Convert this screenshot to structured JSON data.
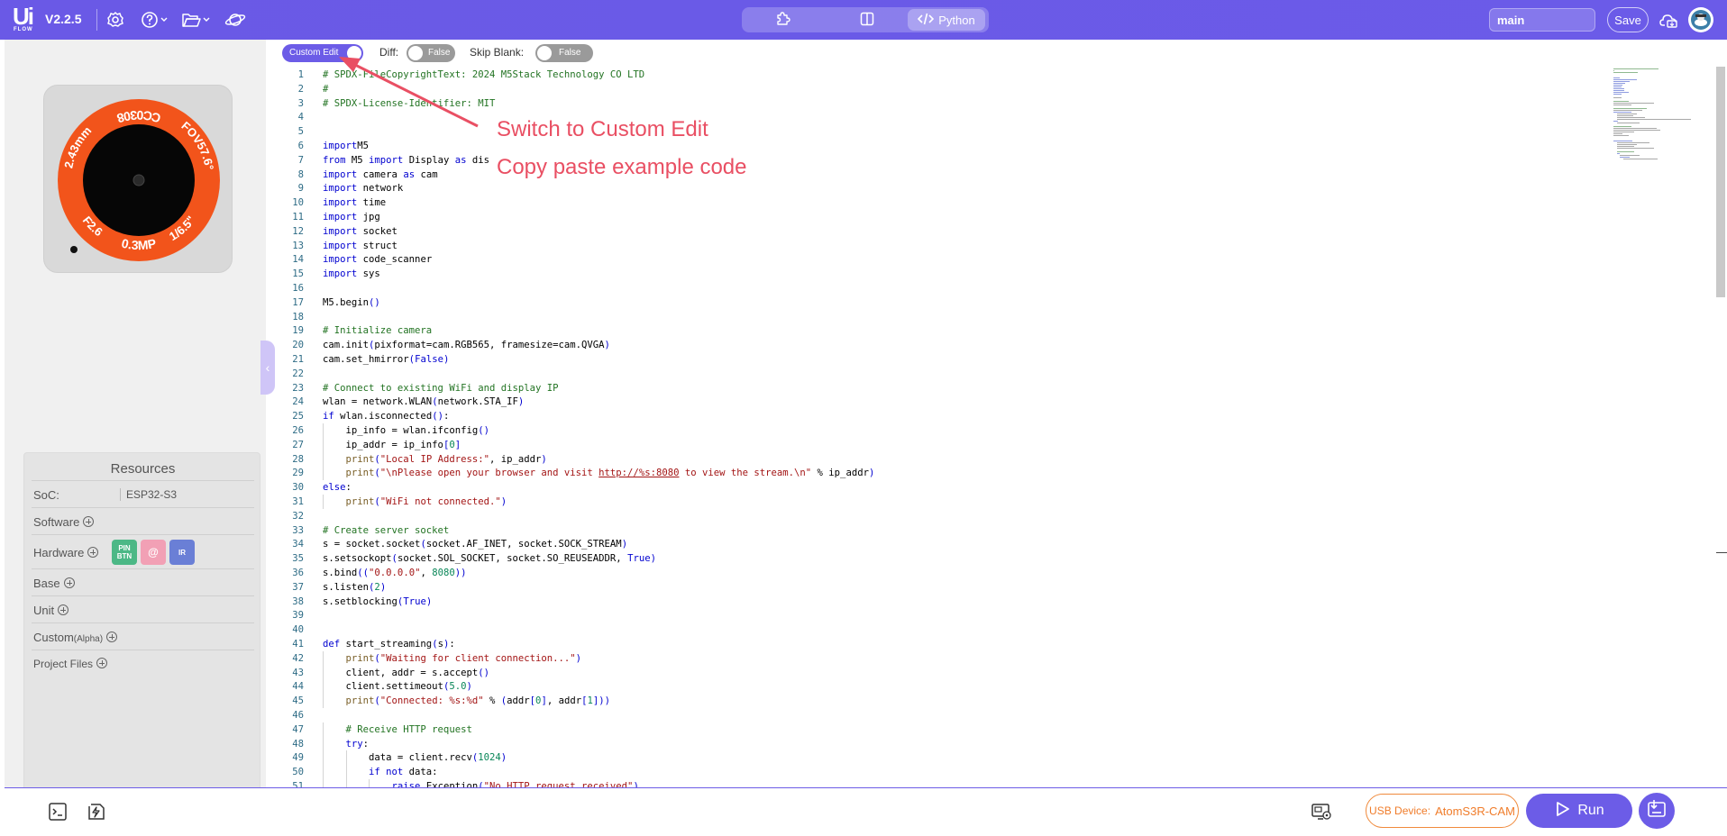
{
  "header": {
    "logo_main": "Ui",
    "logo_sub": "FLOW",
    "version": "V2.2.5",
    "icons": [
      "gear-icon",
      "help-icon",
      "folder-icon",
      "planet-icon"
    ],
    "modes": [
      {
        "name": "blocks",
        "icon": "puzzle-icon",
        "label": ""
      },
      {
        "name": "split",
        "icon": "split-icon",
        "label": ""
      },
      {
        "name": "python",
        "icon": "code-icon",
        "label": "Python"
      }
    ],
    "branch_value": "main",
    "save_label": "Save",
    "right_icons": [
      "cloud-icon",
      "avatar"
    ]
  },
  "editor_toolbar": {
    "custom_edit_label": "Custom Edit",
    "diff_label": "Diff:",
    "diff_value": "False",
    "skip_blank_label": "Skip Blank:",
    "skip_blank_value": "False"
  },
  "device": {
    "ring_top": "CC0308",
    "ring_right": "FOV57.6°",
    "ring_right2": "1/6.5\"",
    "ring_bottom": "0.3MP",
    "ring_left": "2.43mm",
    "ring_left2": "F2.6"
  },
  "resources": {
    "title": "Resources",
    "soc_label": "SoC:",
    "soc_value": "ESP32-S3",
    "software_label": "Software",
    "hardware_label": "Hardware",
    "hardware_chips": [
      {
        "label": "PIN BTN",
        "color": "#4cb886"
      },
      {
        "label": "@",
        "color": "#f2a0b5"
      },
      {
        "label": "IR",
        "color": "#6a7fd6"
      }
    ],
    "base_label": "Base",
    "unit_label": "Unit",
    "custom_label": "Custom",
    "custom_sub": "(Alpha)",
    "project_files_label": "Project Files"
  },
  "annotations": {
    "line1": "Switch to Custom Edit",
    "line2": "Copy paste example code"
  },
  "code_lines": [
    [
      [
        "cm",
        "# SPDX-FileCopyrightText: 2024 M5Stack Technology CO LTD"
      ]
    ],
    [
      [
        "cm",
        "#"
      ]
    ],
    [
      [
        "cm",
        "# SPDX-License-Identifier: MIT"
      ]
    ],
    [],
    [],
    [
      [
        "kw",
        "import"
      ],
      [
        "",
        "M5"
      ]
    ],
    [
      [
        "kw",
        "from"
      ],
      [
        "",
        " M5 "
      ],
      [
        "kw",
        "import"
      ],
      [
        "",
        " Display "
      ],
      [
        "kw",
        "as"
      ],
      [
        "",
        " dis"
      ]
    ],
    [
      [
        "kw",
        "import"
      ],
      [
        "",
        " camera "
      ],
      [
        "kw",
        "as"
      ],
      [
        "",
        " cam"
      ]
    ],
    [
      [
        "kw",
        "import"
      ],
      [
        "",
        " network"
      ]
    ],
    [
      [
        "kw",
        "import"
      ],
      [
        "",
        " time"
      ]
    ],
    [
      [
        "kw",
        "import"
      ],
      [
        "",
        " jpg"
      ]
    ],
    [
      [
        "kw",
        "import"
      ],
      [
        "",
        " socket"
      ]
    ],
    [
      [
        "kw",
        "import"
      ],
      [
        "",
        " struct"
      ]
    ],
    [
      [
        "kw",
        "import"
      ],
      [
        "",
        " code_scanner"
      ]
    ],
    [
      [
        "kw",
        "import"
      ],
      [
        "",
        " sys"
      ]
    ],
    [],
    [
      [
        "",
        "M5.begin"
      ],
      [
        "kw",
        "()"
      ]
    ],
    [],
    [
      [
        "cm",
        "# Initialize camera"
      ]
    ],
    [
      [
        "",
        "cam.init"
      ],
      [
        "kw",
        "("
      ],
      [
        "",
        "pixformat=cam.RGB565, framesize=cam.QVGA"
      ],
      [
        "kw",
        ")"
      ]
    ],
    [
      [
        "",
        "cam.set_hmirror"
      ],
      [
        "kw",
        "("
      ],
      [
        "kw",
        "False"
      ],
      [
        "kw",
        ")"
      ]
    ],
    [],
    [
      [
        "cm",
        "# Connect to existing WiFi and display IP"
      ]
    ],
    [
      [
        "",
        "wlan = network.WLAN"
      ],
      [
        "kw",
        "("
      ],
      [
        "",
        "network.STA_IF"
      ],
      [
        "kw",
        ")"
      ]
    ],
    [
      [
        "kw",
        "if"
      ],
      [
        "",
        " wlan.isconnected"
      ],
      [
        "kw",
        "()"
      ],
      [
        "",
        ":"
      ]
    ],
    [
      [
        "",
        "    ip_info = wlan.ifconfig"
      ],
      [
        "kw",
        "()"
      ]
    ],
    [
      [
        "",
        "    ip_addr = ip_info"
      ],
      [
        "kw",
        "["
      ],
      [
        "nm",
        "0"
      ],
      [
        "kw",
        "]"
      ]
    ],
    [
      [
        "",
        "    "
      ],
      [
        "bi",
        "print"
      ],
      [
        "kw",
        "("
      ],
      [
        "st",
        "\"Local IP Address:\""
      ],
      [
        "",
        ", ip_addr"
      ],
      [
        "kw",
        ")"
      ]
    ],
    [
      [
        "",
        "    "
      ],
      [
        "bi",
        "print"
      ],
      [
        "kw",
        "("
      ],
      [
        "st",
        "\"\\nPlease open your browser and visit "
      ],
      [
        "url",
        "http://%s:8080"
      ],
      [
        "st",
        " to view the stream.\\n\""
      ],
      [
        "",
        " % ip_addr"
      ],
      [
        "kw",
        ")"
      ]
    ],
    [
      [
        "kw",
        "else"
      ],
      [
        "",
        ":"
      ]
    ],
    [
      [
        "",
        "    "
      ],
      [
        "bi",
        "print"
      ],
      [
        "kw",
        "("
      ],
      [
        "st",
        "\"WiFi not connected.\""
      ],
      [
        "kw",
        ")"
      ]
    ],
    [],
    [
      [
        "cm",
        "# Create server socket"
      ]
    ],
    [
      [
        "",
        "s = socket.socket"
      ],
      [
        "kw",
        "("
      ],
      [
        "",
        "socket.AF_INET, socket.SOCK_STREAM"
      ],
      [
        "kw",
        ")"
      ]
    ],
    [
      [
        "",
        "s.setsockopt"
      ],
      [
        "kw",
        "("
      ],
      [
        "",
        "socket.SOL_SOCKET, socket.SO_REUSEADDR, "
      ],
      [
        "kw",
        "True"
      ],
      [
        "kw",
        ")"
      ]
    ],
    [
      [
        "",
        "s.bind"
      ],
      [
        "kw",
        "(("
      ],
      [
        "st",
        "\"0.0.0.0\""
      ],
      [
        "",
        ", "
      ],
      [
        "nm",
        "8080"
      ],
      [
        "kw",
        "))"
      ]
    ],
    [
      [
        "",
        "s.listen"
      ],
      [
        "kw",
        "("
      ],
      [
        "nm",
        "2"
      ],
      [
        "kw",
        ")"
      ]
    ],
    [
      [
        "",
        "s.setblocking"
      ],
      [
        "kw",
        "("
      ],
      [
        "kw",
        "True"
      ],
      [
        "kw",
        ")"
      ]
    ],
    [],
    [],
    [
      [
        "kw",
        "def"
      ],
      [
        "",
        " start_streaming"
      ],
      [
        "kw",
        "("
      ],
      [
        "",
        "s"
      ],
      [
        "kw",
        ")"
      ],
      [
        "",
        ":"
      ]
    ],
    [
      [
        "",
        "    "
      ],
      [
        "bi",
        "print"
      ],
      [
        "kw",
        "("
      ],
      [
        "st",
        "\"Waiting for client connection...\""
      ],
      [
        "kw",
        ")"
      ]
    ],
    [
      [
        "",
        "    client, addr = s.accept"
      ],
      [
        "kw",
        "()"
      ]
    ],
    [
      [
        "",
        "    client.settimeout"
      ],
      [
        "kw",
        "("
      ],
      [
        "nm",
        "5.0"
      ],
      [
        "kw",
        ")"
      ]
    ],
    [
      [
        "",
        "    "
      ],
      [
        "bi",
        "print"
      ],
      [
        "kw",
        "("
      ],
      [
        "st",
        "\"Connected: %s:%d\""
      ],
      [
        "",
        " % "
      ],
      [
        "kw",
        "("
      ],
      [
        "",
        "addr"
      ],
      [
        "kw",
        "["
      ],
      [
        "nm",
        "0"
      ],
      [
        "kw",
        "]"
      ],
      [
        "",
        ", addr"
      ],
      [
        "kw",
        "["
      ],
      [
        "nm",
        "1"
      ],
      [
        "kw",
        "]))"
      ]
    ],
    [],
    [
      [
        "cm",
        "    # Receive HTTP request"
      ]
    ],
    [
      [
        "kw",
        "    try"
      ],
      [
        "",
        ":"
      ]
    ],
    [
      [
        "",
        "        data = client.recv"
      ],
      [
        "kw",
        "("
      ],
      [
        "nm",
        "1024"
      ],
      [
        "kw",
        ")"
      ]
    ],
    [
      [
        "kw",
        "        if not"
      ],
      [
        "",
        " data:"
      ]
    ],
    [
      [
        "",
        "            "
      ],
      [
        "kw",
        "raise"
      ],
      [
        "",
        " Exception"
      ],
      [
        "kw",
        "("
      ],
      [
        "st",
        "\"No HTTP request received\""
      ],
      [
        "kw",
        ")"
      ]
    ]
  ],
  "bottom": {
    "left_icons": [
      "terminal-icon",
      "flash-icon"
    ],
    "device_manager_icon": "device-manager-icon",
    "usb_label": "USB Device:",
    "usb_device": "AtomS3R-CAM",
    "run_label": "Run",
    "flash_button_icon": "download-device-icon"
  },
  "colors": {
    "accent": "#6c5ce7",
    "annotation": "#e94f63",
    "usb_orange": "#f07c2a",
    "lens_ring": "#f2541b"
  }
}
